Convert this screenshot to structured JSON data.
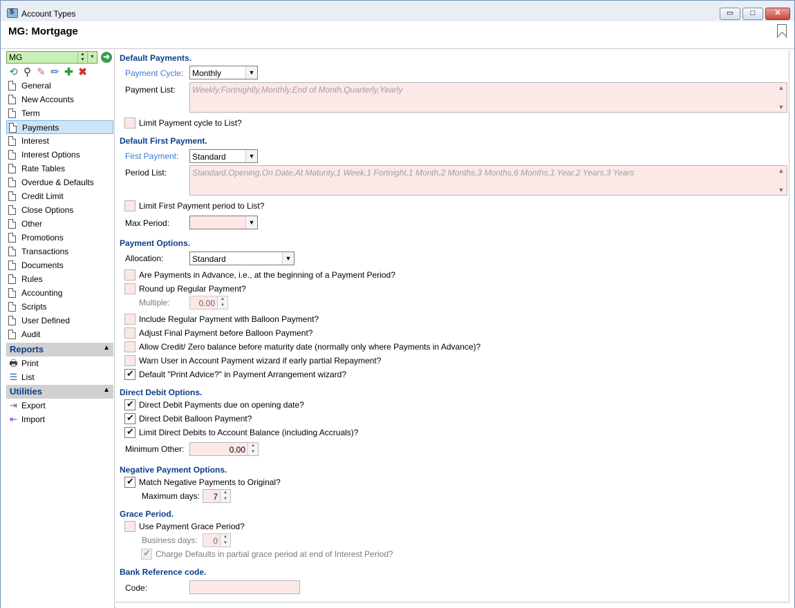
{
  "window": {
    "title": "Account Types",
    "page_title": "MG: Mortgage",
    "buttons": {
      "minimize": "▭",
      "maximize": "□",
      "close": "✕"
    }
  },
  "sidebar": {
    "selector_value": "MG",
    "nav_items": [
      "General",
      "New Accounts",
      "Term",
      "Payments",
      "Interest",
      "Interest Options",
      "Rate Tables",
      "Overdue & Defaults",
      "Credit Limit",
      "Close Options",
      "Other",
      "Promotions",
      "Transactions",
      "Documents",
      "Rules",
      "Accounting",
      "Scripts",
      "User Defined",
      "Audit"
    ],
    "selected_index": 3,
    "reports": {
      "title": "Reports",
      "items": [
        "Print",
        "List"
      ]
    },
    "utilities": {
      "title": "Utilities",
      "items": [
        "Export",
        "Import"
      ]
    }
  },
  "default_payments": {
    "title": "Default Payments.",
    "payment_cycle_label": "Payment Cycle:",
    "payment_cycle_value": "Monthly",
    "payment_list_label": "Payment List:",
    "payment_list_placeholder": "Weekly,Fortnightly,Monthly,End of Month,Quarterly,Yearly",
    "limit_cycle_label": "Limit Payment cycle to List?",
    "limit_cycle_checked": false
  },
  "default_first_payment": {
    "title": "Default First Payment.",
    "first_payment_label": "First Payment:",
    "first_payment_value": "Standard",
    "period_list_label": "Period List:",
    "period_list_placeholder": "Standard,Opening,On Date,At Maturity,1 Week,1 Fortnight,1 Month,2 Months,3 Months,6 Months,1 Year,2 Years,3 Years",
    "limit_first_label": "Limit First Payment period to List?",
    "limit_first_checked": false,
    "max_period_label": "Max Period:",
    "max_period_value": ""
  },
  "payment_options": {
    "title": "Payment Options.",
    "allocation_label": "Allocation:",
    "allocation_value": "Standard",
    "in_advance_label": "Are Payments in Advance, i.e., at the beginning of a Payment Period?",
    "round_up_label": "Round up Regular Payment?",
    "multiple_label": "Multiple:",
    "multiple_value": "0.00",
    "include_regular_label": "Include Regular Payment with Balloon Payment?",
    "adjust_final_label": "Adjust Final Payment before Balloon Payment?",
    "allow_credit_label": "Allow Credit/ Zero balance before maturity date (normally only where Payments in Advance)?",
    "warn_user_label": "Warn User in Account Payment wizard if early partial Repayment?",
    "default_print_label": "Default \"Print Advice?\" in Payment Arrangement wizard?",
    "default_print_checked": true
  },
  "direct_debit": {
    "title": "Direct Debit Options.",
    "due_on_opening_label": "Direct Debit Payments due on opening date?",
    "balloon_label": "Direct Debit Balloon Payment?",
    "limit_balance_label": "Limit Direct Debits to Account Balance (including Accruals)?",
    "minimum_other_label": "Minimum Other:",
    "minimum_other_value": "0.00"
  },
  "negative_payment": {
    "title": "Negative Payment Options.",
    "match_label": "Match Negative Payments to Original?",
    "max_days_label": "Maximum days:",
    "max_days_value": "7"
  },
  "grace_period": {
    "title": "Grace Period.",
    "use_grace_label": "Use Payment Grace Period?",
    "business_days_label": "Business days:",
    "business_days_value": "0",
    "charge_defaults_label": "Charge Defaults in partial grace period at end of Interest Period?"
  },
  "bank_reference": {
    "title": "Bank Reference code.",
    "code_label": "Code:",
    "code_value": ""
  },
  "colors": {
    "section_title": "#0a3e8c",
    "field_blue": "#3a7ad4",
    "field_pink": "#fde8e8",
    "selector_green": "#c9f0b4"
  }
}
